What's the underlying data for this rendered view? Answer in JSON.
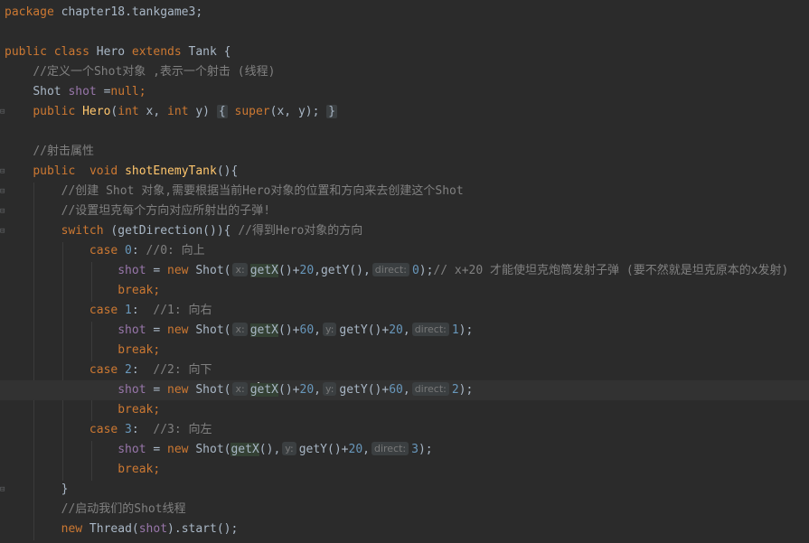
{
  "lines": {
    "l1": {
      "kw": "package",
      "rest": " chapter18.tankgame3;"
    },
    "l3": {
      "kw1": "public",
      "kw2": "class",
      "cls": " Hero ",
      "kw3": "extends",
      "rest": " Tank {"
    },
    "l4": {
      "comment": "//定义一个Shot对象 ,表示一个射击 (线程)"
    },
    "l5": {
      "type": "Shot ",
      "fld": "shot",
      "eq": " =",
      "kw": "null",
      "semi": ";"
    },
    "l6": {
      "kw1": "public",
      "fn": "Hero",
      "p1": "(",
      "kw2": "int",
      "x": " x, ",
      "kw3": "int",
      "y": " y)",
      "brace_open": "{",
      "kw4": "super",
      "args": "(x, y);",
      "brace_close": "}"
    },
    "l8": {
      "comment": "//射击属性"
    },
    "l9": {
      "kw1": "public",
      "kw2": "void",
      "fn": "shotEnemyTank",
      "rest": "(){"
    },
    "l10": {
      "comment": "//创建 Shot 对象,需要根据当前Hero对象的位置和方向来去创建这个Shot"
    },
    "l11": {
      "comment": "//设置坦克每个方向对应所射出的子弹!"
    },
    "l12": {
      "kw": "switch",
      "rest": " (getDirection()){ ",
      "comment": "//得到Hero对象的方向"
    },
    "l13": {
      "kw": "case",
      "num": " 0",
      "colon": ": ",
      "comment": "//0: 向上"
    },
    "l14": {
      "fld": "shot",
      "eq": " = ",
      "kw": "new",
      "cls": " Shot(",
      "hint_x": "x:",
      "getx": "getX",
      "p1": "()+",
      "n1": "20",
      "mid": ",getY(),",
      "hint_d": "direct:",
      "n2": "0",
      "end": ");",
      "comment": "// x+20 才能使坦克炮筒发射子弹 (要不然就是坦克原本的x发射)"
    },
    "l15": {
      "kw": "break",
      "semi": ";"
    },
    "l16": {
      "kw": "case",
      "num": " 1",
      "colon": ":  ",
      "comment": "//1: 向右"
    },
    "l17": {
      "fld": "shot",
      "eq": " = ",
      "kw": "new",
      "cls": " Shot(",
      "hint_x": "x:",
      "getx": "getX",
      "p1": "()+",
      "n1": "60",
      "comma": ",",
      "hint_y": "y:",
      "gety": "getY()+",
      "n2": "20",
      "comma2": ",",
      "hint_d": "direct:",
      "n3": "1",
      "end": ");"
    },
    "l18": {
      "kw": "break",
      "semi": ";"
    },
    "l19": {
      "kw": "case",
      "num": " 2",
      "colon": ":  ",
      "comment": "//2: 向下"
    },
    "l20": {
      "fld": "shot",
      "eq": " = ",
      "kw": "new",
      "cls": " Shot(",
      "hint_x": "x:",
      "g": "g",
      "etx": "etX",
      "p1": "()+",
      "n1": "20",
      "comma": ",",
      "hint_y": "y:",
      "gety": "getY()+",
      "n2": "60",
      "comma2": ",",
      "hint_d": "direct:",
      "n3": "2",
      "end": ");"
    },
    "l21": {
      "kw": "break",
      "semi": ";"
    },
    "l22": {
      "kw": "case",
      "num": " 3",
      "colon": ":  ",
      "comment": "//3: 向左"
    },
    "l23": {
      "fld": "shot",
      "eq": " = ",
      "kw": "new",
      "cls": " Shot(",
      "getx": "getX",
      "p1": "(),",
      "hint_y": "y:",
      "gety": "getY()+",
      "n2": "20",
      "comma2": ",",
      "hint_d": "direct:",
      "n3": "3",
      "end": ");"
    },
    "l24": {
      "kw": "break",
      "semi": ";"
    },
    "l25": {
      "brace": "}"
    },
    "l26": {
      "comment": "//启动我们的Shot线程"
    },
    "l27": {
      "kw": "new",
      "cls": " Thread(",
      "fld": "shot",
      "end": ").start();"
    }
  }
}
